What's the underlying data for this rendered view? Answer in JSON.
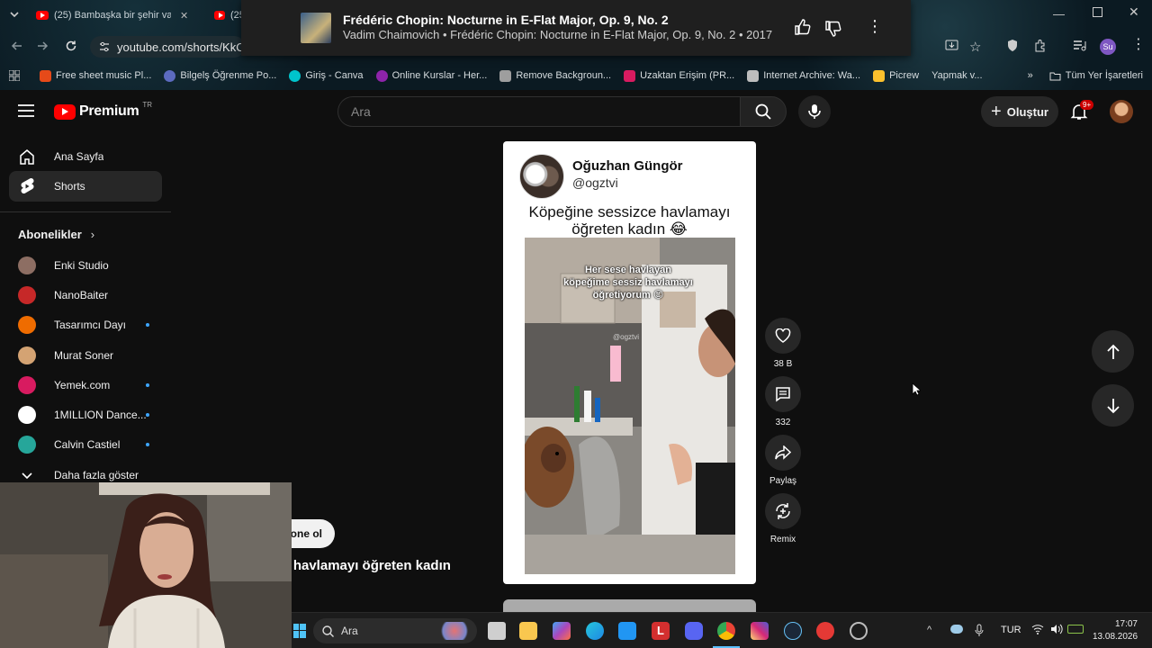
{
  "browser": {
    "tabs": [
      {
        "label": "(25) Bambaşka bir şehir vaar..."
      },
      {
        "label": "(25"
      }
    ],
    "address": "youtube.com/shorts/KkCk",
    "bookmarks": [
      {
        "label": "Free sheet music Pl...",
        "color": "#e64a19"
      },
      {
        "label": "Bilgelş Öğrenme Po...",
        "color": "#5c6bc0"
      },
      {
        "label": "Giriş - Canva",
        "color": "#00c4cc"
      },
      {
        "label": "Online Kurslar - Her...",
        "color": "#8e24aa"
      },
      {
        "label": "Remove Backgroun...",
        "color": "#9e9e9e"
      },
      {
        "label": "Uzaktan Erişim (PR...",
        "color": "#d81b60"
      },
      {
        "label": "Internet Archive: Wa...",
        "color": "#bdbdbd"
      },
      {
        "label": "Picrew",
        "color": "#fbc02d"
      },
      {
        "label": "Yapmak v...",
        "color": "#757575"
      }
    ],
    "all_bookmarks": "Tüm Yer İşaretleri",
    "profile_initials": "Su"
  },
  "media_popup": {
    "title": "Frédéric Chopin: Nocturne in E-Flat Major, Op. 9, No. 2",
    "subtitle": "Vadim Chaimovich • Frédéric Chopin: Nocturne in E-Flat Major, Op. 9, No. 2 • 2017"
  },
  "youtube": {
    "logo_text": "Premium",
    "region": "TR",
    "search_placeholder": "Ara",
    "create_label": "Oluştur",
    "notif_badge": "9+"
  },
  "sidebar": {
    "home": "Ana Sayfa",
    "shorts": "Shorts",
    "subscriptions_title": "Abonelikler",
    "channels": [
      {
        "name": "Enki Studio",
        "dot": false,
        "color": "#8d6e63"
      },
      {
        "name": "NanoBaiter",
        "dot": false,
        "color": "#c62828"
      },
      {
        "name": "Tasarımcı Dayı",
        "dot": true,
        "color": "#ef6c00"
      },
      {
        "name": "Murat Soner",
        "dot": false,
        "color": "#d4a373"
      },
      {
        "name": "Yemek.com",
        "dot": true,
        "color": "#d81b60"
      },
      {
        "name": "1MILLION Dance...",
        "dot": true,
        "color": "#ffffff"
      },
      {
        "name": "Calvin Castiel",
        "dot": true,
        "color": "#26a69a"
      }
    ],
    "show_more": "Daha fazla göster"
  },
  "short": {
    "author": "Oğuzhan Güngör",
    "handle": "@ogztvi",
    "caption_line1": "Köpeğine sessizce havlamayı",
    "caption_line2": "öğreten kadın 😂",
    "overlay_text": "Her sese havlayan köpeğime sessiz havlamayı öğretiyorum 😊",
    "watermark": "@ogztvi",
    "subscribe_label": "bone ol",
    "title_fragment": "iz havlamayı öğreten kadın"
  },
  "actions": {
    "likes": "38 B",
    "comments": "332",
    "share": "Paylaş",
    "remix": "Remix"
  },
  "taskbar": {
    "search": "Ara",
    "lang": "TUR",
    "time": "17:07",
    "date": "13.08.2026"
  }
}
